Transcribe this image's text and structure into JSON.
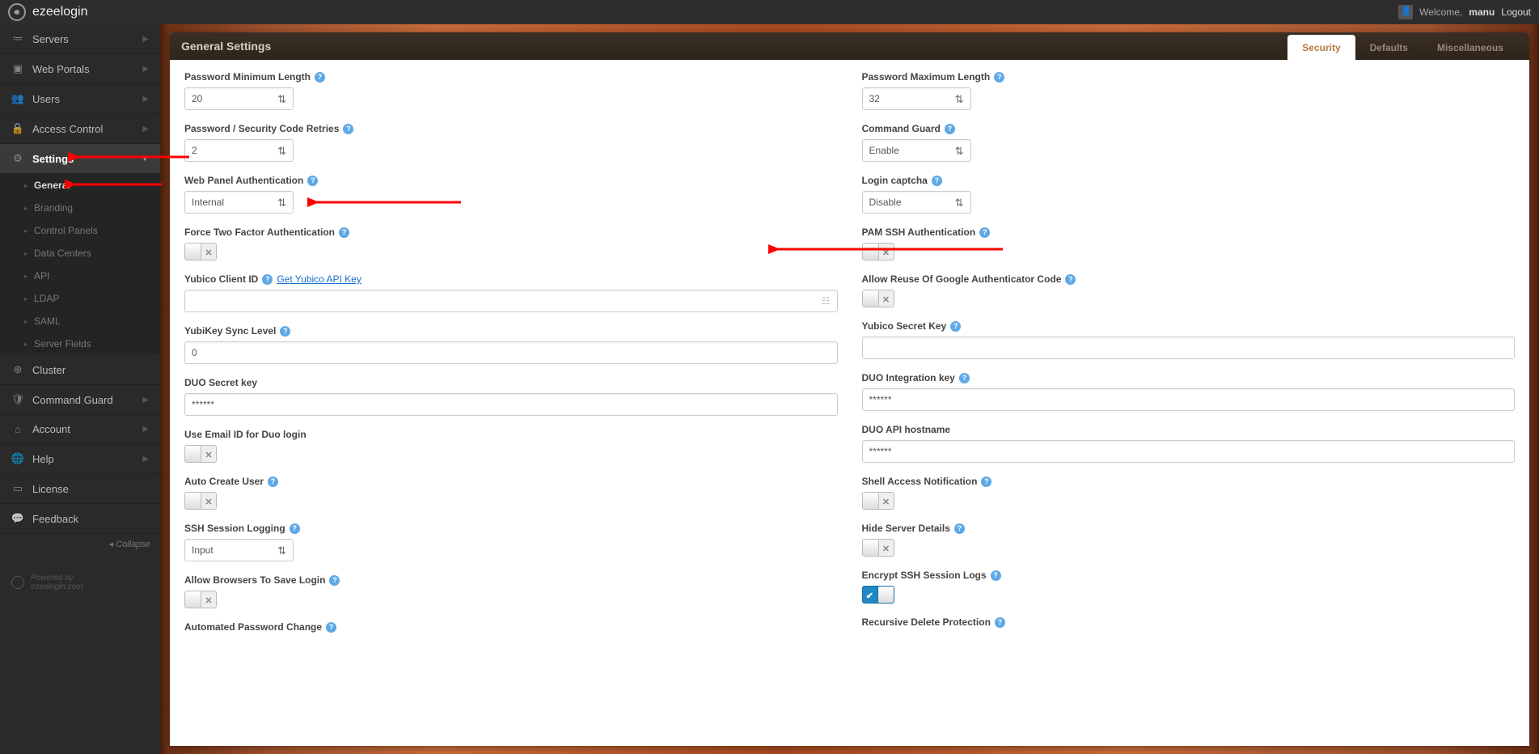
{
  "brand": "ezeelogin",
  "userbox": {
    "welcome": "Welcome,",
    "username": "manu",
    "logout": "Logout"
  },
  "sidebar": {
    "items": [
      {
        "label": "Servers",
        "icon": "≔"
      },
      {
        "label": "Web Portals",
        "icon": "▣"
      },
      {
        "label": "Users",
        "icon": "👥"
      },
      {
        "label": "Access Control",
        "icon": "🔒"
      },
      {
        "label": "Settings",
        "icon": "⚙"
      },
      {
        "label": "Cluster",
        "icon": "⊛"
      },
      {
        "label": "Command Guard",
        "icon": "🛡"
      },
      {
        "label": "Account",
        "icon": "⌂"
      },
      {
        "label": "Help",
        "icon": "🌐"
      },
      {
        "label": "License",
        "icon": "▭"
      },
      {
        "label": "Feedback",
        "icon": "💬"
      }
    ],
    "sub": [
      "General",
      "Branding",
      "Control Panels",
      "Data Centers",
      "API",
      "LDAP",
      "SAML",
      "Server Fields"
    ],
    "collapse": "Collapse",
    "powered1": "Powered by",
    "powered2": "ezeelogin.com"
  },
  "panel": {
    "title": "General Settings",
    "tabs": [
      "Security",
      "Defaults",
      "Miscellaneous"
    ],
    "left": {
      "pwd_min_label": "Password Minimum Length",
      "pwd_min_value": "20",
      "retries_label": "Password / Security Code Retries",
      "retries_value": "2",
      "webauth_label": "Web Panel Authentication",
      "webauth_value": "Internal",
      "force2fa_label": "Force Two Factor Authentication",
      "yubico_id_label": "Yubico Client ID",
      "yubico_link": " Get Yubico API Key",
      "yubikey_sync_label": "YubiKey Sync Level",
      "yubikey_sync_value": "0",
      "duo_secret_label": "DUO Secret key",
      "duo_secret_value": "******",
      "use_email_duo_label": "Use Email ID for Duo login",
      "auto_create_label": "Auto Create User",
      "ssh_log_label": "SSH Session Logging",
      "ssh_log_value": "Input",
      "allow_browser_label": "Allow Browsers To Save Login",
      "auto_pwd_change_label": "Automated Password Change"
    },
    "right": {
      "pwd_max_label": "Password Maximum Length",
      "pwd_max_value": "32",
      "cmd_guard_label": "Command Guard",
      "cmd_guard_value": "Enable",
      "captcha_label": "Login captcha",
      "captcha_value": "Disable",
      "pam_label": "PAM SSH Authentication",
      "reuse_gauth_label": "Allow Reuse Of Google Authenticator Code",
      "yubico_secret_label": "Yubico Secret Key",
      "duo_int_label": "DUO Integration key",
      "duo_int_value": "******",
      "duo_api_label": "DUO API hostname",
      "duo_api_value": "******",
      "shell_notif_label": "Shell Access Notification",
      "hide_server_label": "Hide Server Details",
      "encrypt_ssh_label": "Encrypt SSH Session Logs",
      "recursive_del_label": "Recursive Delete Protection"
    }
  }
}
